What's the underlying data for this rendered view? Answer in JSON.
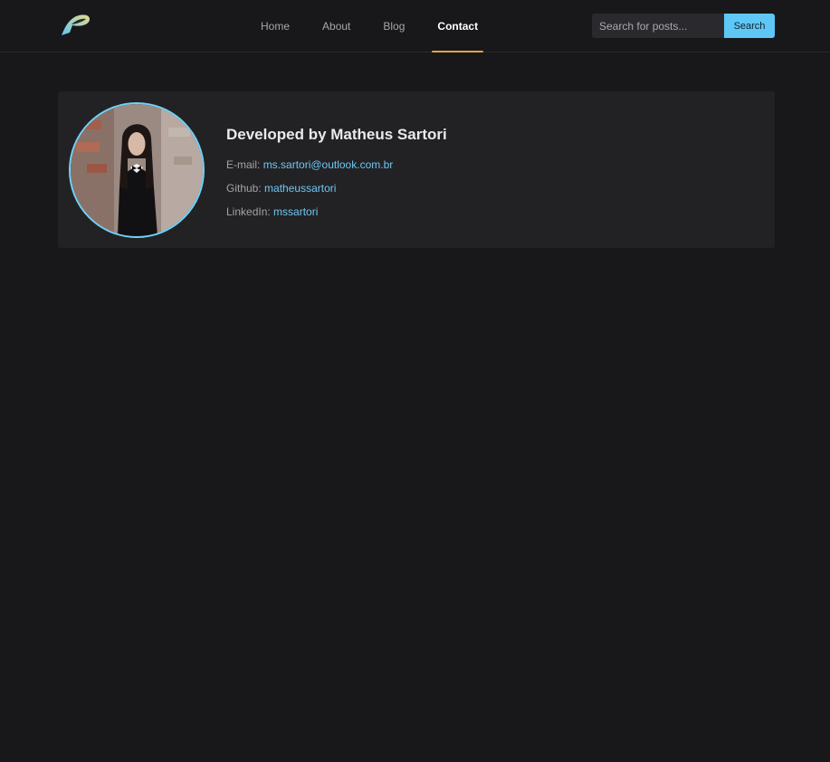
{
  "header": {
    "logo_icon": "feather-p-logo-icon",
    "nav": [
      {
        "label": "Home",
        "active": false
      },
      {
        "label": "About",
        "active": false
      },
      {
        "label": "Blog",
        "active": false
      },
      {
        "label": "Contact",
        "active": true
      }
    ],
    "search": {
      "placeholder": "Search for posts...",
      "value": "",
      "button_label": "Search"
    }
  },
  "profile": {
    "title": "Developed by Matheus Sartori",
    "avatar_icon": "profile-photo",
    "contacts": [
      {
        "label": "E-mail:",
        "value": "ms.sartori@outlook.com.br"
      },
      {
        "label": "Github:",
        "value": "matheussartori"
      },
      {
        "label": "LinkedIn:",
        "value": "mssartori"
      }
    ]
  },
  "colors": {
    "background": "#18181a",
    "card": "#222225",
    "accent": "#5ec7f5",
    "link": "#6ec7f2",
    "active_underline": "#e8a33a"
  }
}
